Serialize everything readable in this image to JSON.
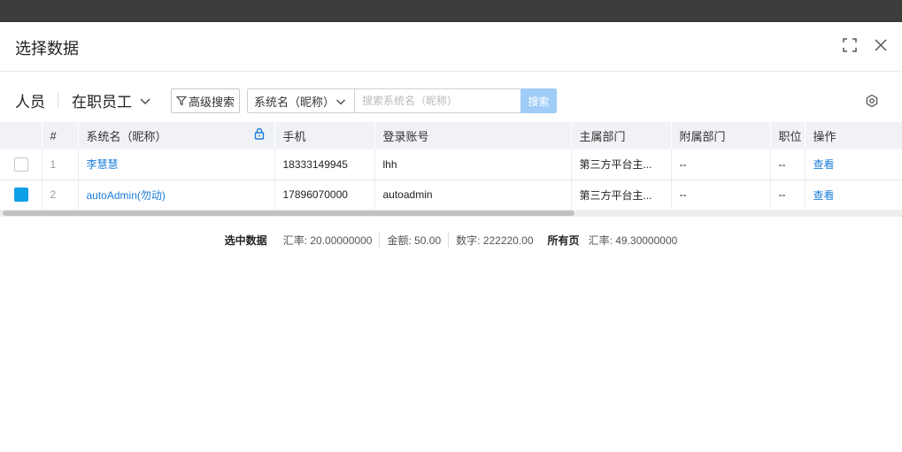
{
  "dialog": {
    "title": "选择数据"
  },
  "toolbar": {
    "title": "人员",
    "status": "在职员工",
    "advanced_search": "高级搜索",
    "field_select": "系统名（昵称）",
    "search_placeholder": "搜索系统名（昵称）",
    "search_button": "搜索"
  },
  "table": {
    "columns": [
      "#",
      "系统名（昵称）",
      "手机",
      "登录账号",
      "主属部门",
      "附属部门",
      "职位",
      "操作"
    ],
    "rows": [
      {
        "checked": false,
        "index": "1",
        "name": "李慧慧",
        "phone": "18333149945",
        "account": "lhh",
        "dept": "第三方平台主...",
        "sub_dept": "--",
        "position": "--",
        "action": "查看"
      },
      {
        "checked": true,
        "index": "2",
        "name": "autoAdmin(勿动)",
        "phone": "17896070000",
        "account": "autoadmin",
        "dept": "第三方平台主...",
        "sub_dept": "--",
        "position": "--",
        "action": "查看"
      }
    ]
  },
  "summary": {
    "selected_label": "选中数据",
    "selected_rate": "汇率: 20.00000000",
    "selected_amount": "金额: 50.00",
    "selected_number": "数字: 222220.00",
    "all_label": "所有页",
    "all_rate": "汇率: 49.30000000"
  },
  "colors": {
    "link": "#1a7cdb",
    "checkbox_checked": "#0ea0e6",
    "search_button": "#9fcdf7"
  }
}
